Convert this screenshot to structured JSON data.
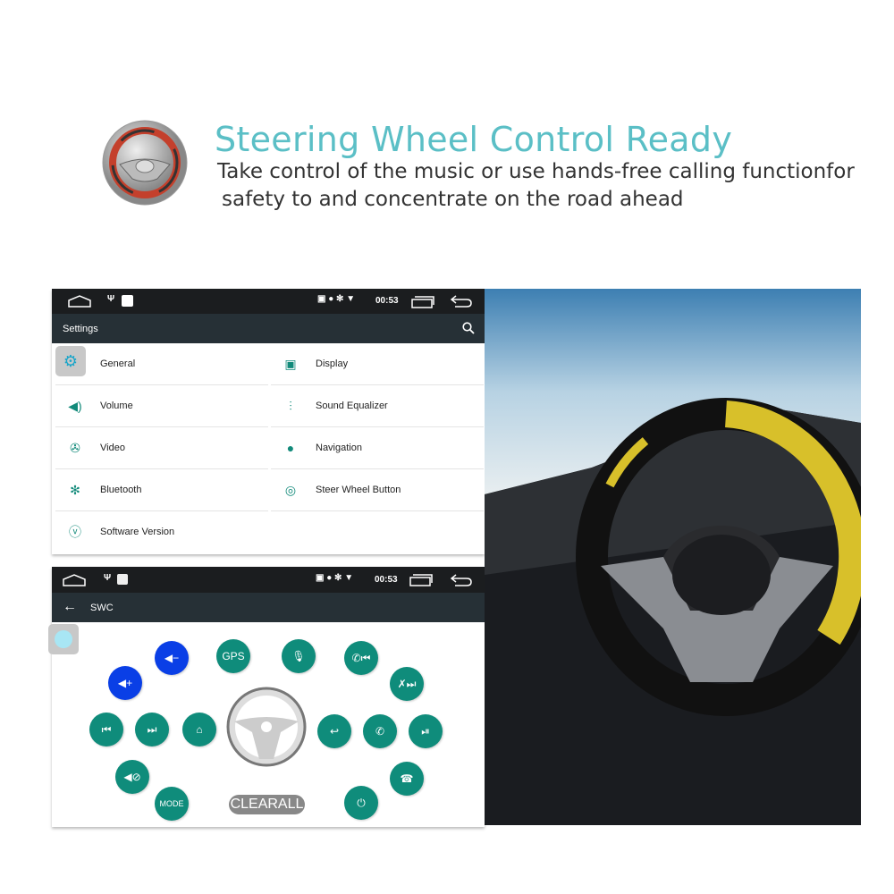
{
  "header": {
    "title": "Steering Wheel Control Ready",
    "subtitle_line1": "Take control of the music or use hands-free calling functionfor",
    "subtitle_line2": "safety to and concentrate on the road ahead"
  },
  "status": {
    "time": "00:53"
  },
  "settings": {
    "title": "Settings",
    "items": [
      {
        "label": "General",
        "icon": "gear-icon"
      },
      {
        "label": "Display",
        "icon": "display-icon"
      },
      {
        "label": "Volume",
        "icon": "volume-icon"
      },
      {
        "label": "Sound Equalizer",
        "icon": "equalizer-icon"
      },
      {
        "label": "Video",
        "icon": "video-icon"
      },
      {
        "label": "Navigation",
        "icon": "location-pin-icon"
      },
      {
        "label": "Bluetooth",
        "icon": "bluetooth-icon"
      },
      {
        "label": "Steer Wheel Button",
        "icon": "steering-wheel-icon"
      },
      {
        "label": "Software Version",
        "icon": "version-icon"
      }
    ]
  },
  "swc": {
    "title": "SWC",
    "gps": "GPS",
    "mode": "MODE",
    "clear_all": "CLEARALL"
  },
  "colors": {
    "accent": "#0f8c7b",
    "volume_blue": "#0a3fe6",
    "title": "#5bbfc6",
    "bar": "#263036"
  }
}
